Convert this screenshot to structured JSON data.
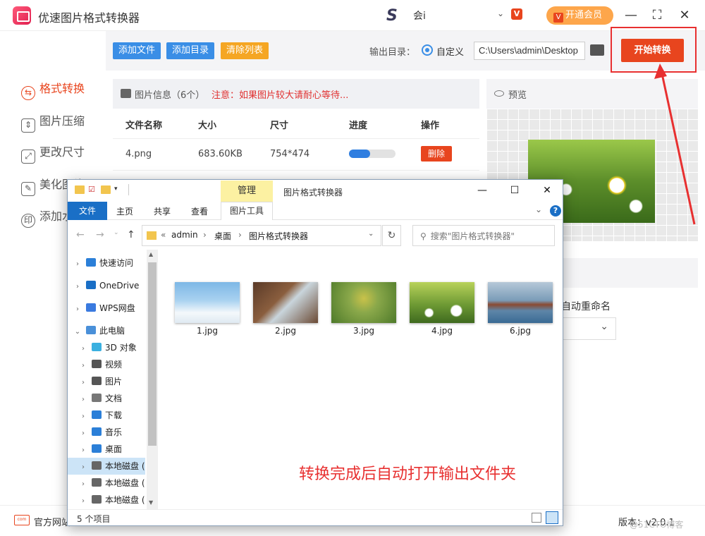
{
  "app": {
    "title": "优速图片格式转换器",
    "user_name": "会i",
    "vip_label": "开通会员",
    "badge": "V",
    "window_controls": {
      "minimize": "—",
      "maximize": "⛶",
      "close": "✕"
    }
  },
  "sidebar": {
    "items": [
      {
        "label": "格式转换",
        "icon": "format-convert-icon",
        "active": true
      },
      {
        "label": "图片压缩",
        "icon": "compress-icon"
      },
      {
        "label": "更改尺寸",
        "icon": "resize-icon"
      },
      {
        "label": "美化图片",
        "icon": "beautify-icon"
      },
      {
        "label": "添加水印",
        "icon": "watermark-icon"
      }
    ]
  },
  "toolbar": {
    "add_file": "添加文件",
    "add_dir": "添加目录",
    "clear_list": "清除列表",
    "output_label": "输出目录：",
    "radio_custom": "自定义",
    "output_path": "C:\\Users\\admin\\Desktop",
    "start_label": "开始转换",
    "colors": {
      "add": "#3a8ee6",
      "clear": "#f5a623",
      "start": "#e8451e"
    }
  },
  "file_table": {
    "info_title": "图片信息（6个）",
    "notice": "注意：如果图片较大请耐心等待...",
    "headers": [
      "文件名称",
      "大小",
      "尺寸",
      "进度",
      "操作"
    ],
    "rows": [
      {
        "name": "4.png",
        "size": "683.60KB",
        "dims": "754*474",
        "progress": 0.45,
        "action": "删除"
      }
    ]
  },
  "preview": {
    "title": "预览",
    "rename_label": "自动重命名"
  },
  "footer": {
    "site_link": "官方网站",
    "version": "版本：v2.0.1",
    "watermark": "@51CTO博客"
  },
  "explorer": {
    "title": "图片格式转换器",
    "context_tab": "管理",
    "tabs": [
      "文件",
      "主页",
      "共享",
      "查看",
      "图片工具"
    ],
    "breadcrumb": [
      "«",
      "admin",
      "›",
      "桌面",
      "›",
      "图片格式转换器"
    ],
    "search_placeholder": "搜索\"图片格式转换器\"",
    "nav_items": [
      {
        "label": "快速访问",
        "icon": "star-icon",
        "color": "#2b7fd8"
      },
      {
        "label": "OneDrive",
        "icon": "cloud-icon",
        "color": "#1a6fc6"
      },
      {
        "label": "WPS网盘",
        "icon": "cloud-icon",
        "color": "#3a7adf"
      },
      {
        "label": "此电脑",
        "icon": "computer-icon",
        "color": "#4a90d9",
        "expanded": true
      },
      {
        "label": "3D 对象",
        "icon": "cube-icon",
        "color": "#3ab0e0"
      },
      {
        "label": "视频",
        "icon": "video-icon",
        "color": "#555"
      },
      {
        "label": "图片",
        "icon": "picture-icon",
        "color": "#555"
      },
      {
        "label": "文档",
        "icon": "document-icon",
        "color": "#777"
      },
      {
        "label": "下载",
        "icon": "download-icon",
        "color": "#2b7fd8"
      },
      {
        "label": "音乐",
        "icon": "music-icon",
        "color": "#2b7fd8"
      },
      {
        "label": "桌面",
        "icon": "desktop-icon",
        "color": "#2b7fd8"
      },
      {
        "label": "本地磁盘 (C:)",
        "icon": "drive-icon",
        "color": "#666",
        "selected": true
      },
      {
        "label": "本地磁盘 (D:)",
        "icon": "drive-icon",
        "color": "#666"
      },
      {
        "label": "本地磁盘 (E:)",
        "icon": "drive-icon",
        "color": "#666"
      }
    ],
    "files": [
      {
        "name": "1.jpg",
        "bg": "linear-gradient(180deg,#7db7e6 0%,#a9d2f0 45%,#f4f8fb 75%,#dfeaf2 100%)"
      },
      {
        "name": "2.jpg",
        "bg": "linear-gradient(135deg,#5a3a28 0%,#8a5e3e 40%,#c9d5dc 55%,#6b4a34 100%)"
      },
      {
        "name": "3.jpg",
        "bg": "radial-gradient(circle at 50% 40%,#c9c24a 0,#8aa84a 35%,#4e7a2a 100%)"
      },
      {
        "name": "4.jpg",
        "bg": "radial-gradient(circle at 72% 70%,#fff 0,#fff 7px,transparent 9px),radial-gradient(circle at 30% 75%,#fff 0,#fff 5px,transparent 7px),linear-gradient(180deg,#b8d25a 0%,#6e9a34 55%,#3f6a1f 100%)"
      },
      {
        "name": "6.jpg",
        "bg": "linear-gradient(180deg,#b6c8d8 0%,#7a9cb8 45%,#8a4a32 55%,#5e86a8 70%,#3a6a94 100%)"
      }
    ],
    "status": "5 个项目",
    "message": "转换完成后自动打开输出文件夹",
    "message_color": "#e83030"
  }
}
